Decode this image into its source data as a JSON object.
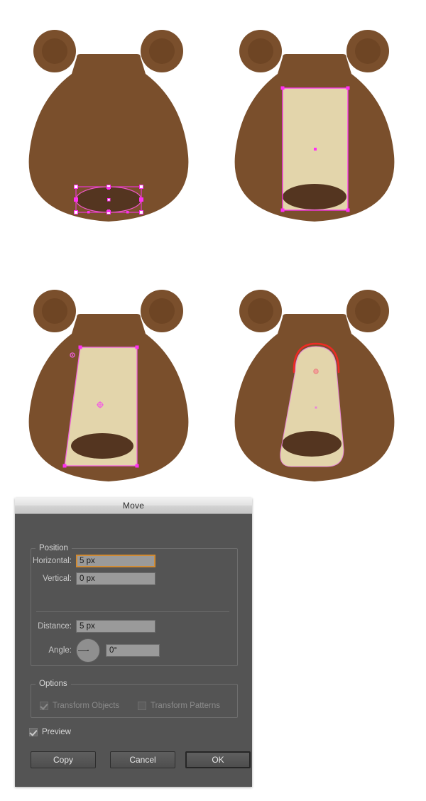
{
  "artwork": {
    "description": "Four-step Adobe Illustrator tutorial showing a bear face muzzle being built",
    "colors": {
      "head_brown": "#7a4f2c",
      "ear_inner_brown": "#6e4524",
      "muzzle_cream": "#e3d5ab",
      "nose_dark_brown": "#543venue",
      "nose_brown": "#543520",
      "selection_magenta": "#ff2ff2",
      "selection_pink": "#e86fd0",
      "highlight_red": "#ee2b24",
      "background_white": "#ffffff"
    },
    "steps": [
      {
        "id": "step-1",
        "caption": "Bear head with elliptical nose selected showing bounding box and anchor points",
        "selected_shape": "ellipse-nose",
        "selection_style": "bounding-box-with-anchors"
      },
      {
        "id": "step-2",
        "caption": "Bear head with cream rectangle muzzle selected showing bounding box",
        "selected_shape": "rectangle-muzzle",
        "selection_style": "bounding-box"
      },
      {
        "id": "step-3",
        "caption": "Bear head with skewed cream muzzle quadrilateral selected",
        "selected_shape": "skewed-muzzle",
        "selection_style": "path-outline-with-anchors"
      },
      {
        "id": "step-4",
        "caption": "Bear head with rounded tapered muzzle, top arc highlighted in red",
        "selected_shape": "rounded-muzzle",
        "selection_style": "path-outline-red-arc"
      }
    ]
  },
  "dialog": {
    "title": "Move",
    "position_group": {
      "legend": "Position",
      "fields": [
        {
          "label": "Horizontal:",
          "value": "5 px",
          "focused": true
        },
        {
          "label": "Vertical:",
          "value": "0 px",
          "focused": false
        },
        {
          "label": "Distance:",
          "value": "5 px",
          "focused": false
        },
        {
          "label": "Angle:",
          "value": "0°",
          "focused": false
        }
      ],
      "horizontal_label": "Horizontal:",
      "horizontal_value": "5 px",
      "vertical_label": "Vertical:",
      "vertical_value": "0 px",
      "distance_label": "Distance:",
      "distance_value": "5 px",
      "angle_label": "Angle:",
      "angle_value": "0°",
      "angle_dial_degrees": 0
    },
    "options_group": {
      "legend": "Options",
      "transform_objects": {
        "label": "Transform Objects",
        "checked": true,
        "disabled": true
      },
      "transform_patterns": {
        "label": "Transform Patterns",
        "checked": false,
        "disabled": true
      }
    },
    "preview": {
      "label": "Preview",
      "checked": true
    },
    "buttons": {
      "copy": "Copy",
      "cancel": "Cancel",
      "ok": "OK",
      "default": "OK"
    },
    "accent_color": "#d08b34",
    "background_color": "#545454"
  }
}
